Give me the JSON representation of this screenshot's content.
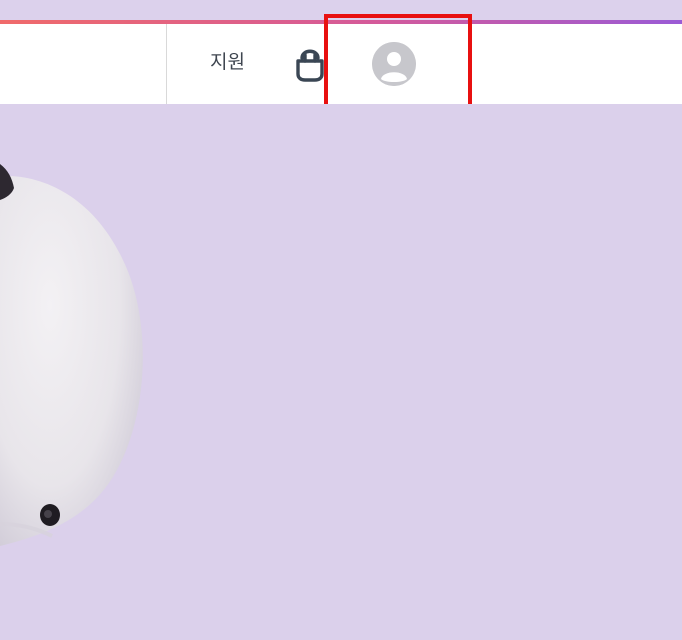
{
  "header": {
    "support_label": "지원",
    "bag_icon": "shopping-bag-icon",
    "avatar_icon": "user-avatar-icon"
  },
  "colors": {
    "background": "#dbd0eb",
    "header_bg": "#ffffff",
    "gradient_start": "#f06a6a",
    "gradient_end": "#9a5bd6",
    "highlight": "#e81010",
    "text": "#3f4650"
  },
  "hero": {
    "product_icon": "white-earbud-product-image"
  }
}
